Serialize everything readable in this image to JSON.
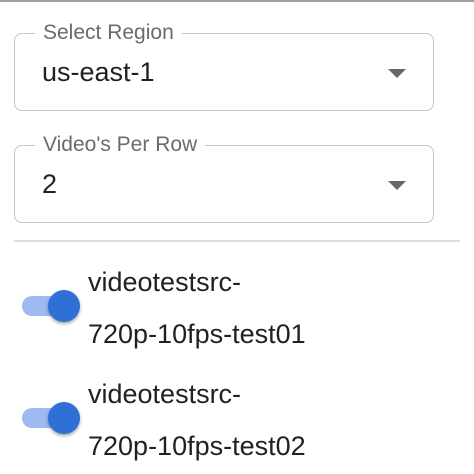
{
  "region_select": {
    "label": "Select Region",
    "value": "us-east-1"
  },
  "per_row_select": {
    "label": "Video's Per Row",
    "value": "2"
  },
  "streams": [
    {
      "name_line1": "videotestsrc-",
      "name_line2": "720p-10fps-test01",
      "enabled": true
    },
    {
      "name_line1": "videotestsrc-",
      "name_line2": "720p-10fps-test02",
      "enabled": true
    }
  ],
  "colors": {
    "switch_thumb": "#2f70d6",
    "switch_track": "#9ebaf0",
    "field_border": "#c4c4c4",
    "label_text": "#6b6b6b"
  },
  "icons": {
    "dropdown": "arrow-drop-down-icon"
  }
}
